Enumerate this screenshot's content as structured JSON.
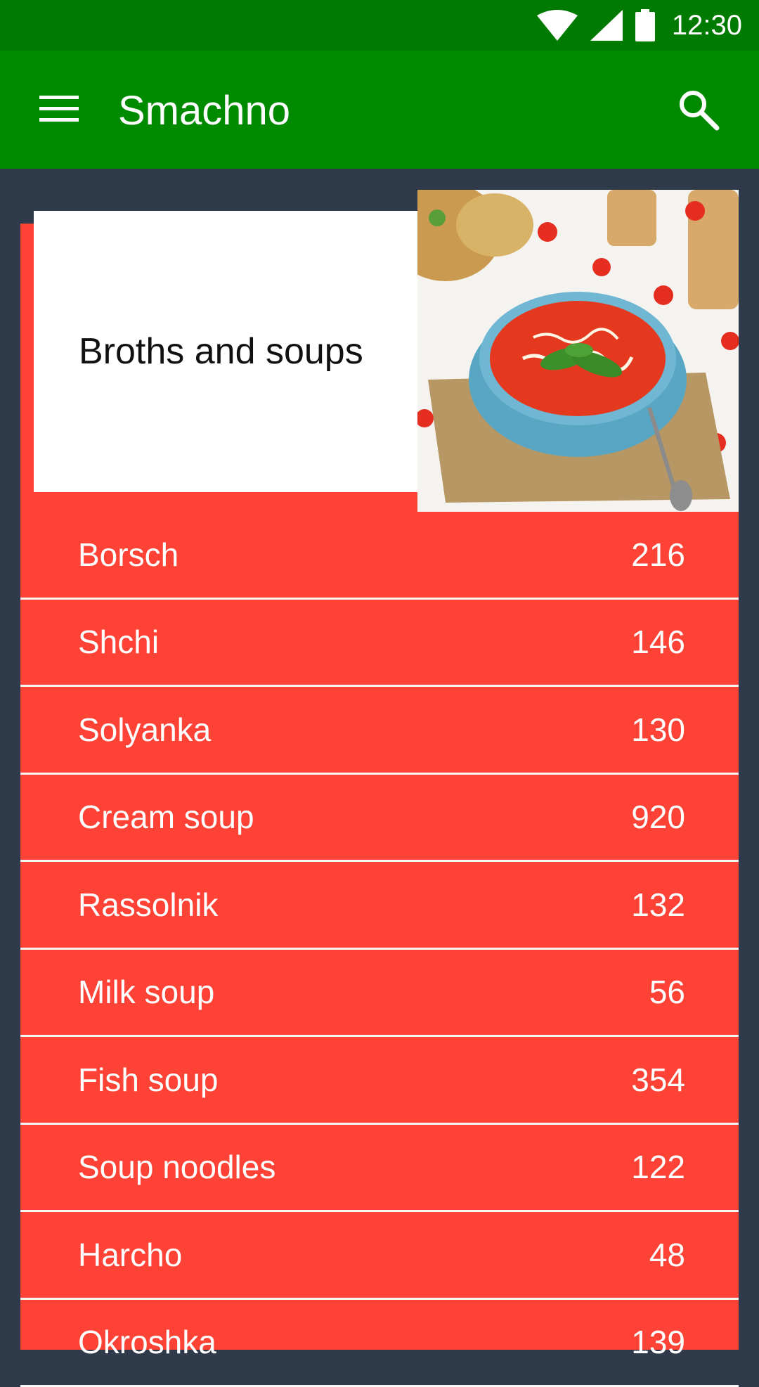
{
  "status_bar": {
    "time": "12:30",
    "icons": [
      "wifi-icon",
      "signal-icon",
      "battery-icon"
    ]
  },
  "app_bar": {
    "title": "Smachno",
    "menu_icon": "menu-icon",
    "search_icon": "search-icon",
    "color": "#008a00",
    "status_color": "#007a00"
  },
  "category": {
    "title": "Broths and soups",
    "accent_color": "#ff4236"
  },
  "recipes": [
    {
      "name": "Borsch",
      "count": "216"
    },
    {
      "name": "Shchi",
      "count": "146"
    },
    {
      "name": "Solyanka",
      "count": "130"
    },
    {
      "name": "Cream soup",
      "count": "920"
    },
    {
      "name": "Rassolnik",
      "count": "132"
    },
    {
      "name": "Milk soup",
      "count": "56"
    },
    {
      "name": "Fish soup",
      "count": "354"
    },
    {
      "name": "Soup noodles",
      "count": "122"
    },
    {
      "name": "Harcho",
      "count": "48"
    },
    {
      "name": "Okroshka",
      "count": "139"
    }
  ]
}
